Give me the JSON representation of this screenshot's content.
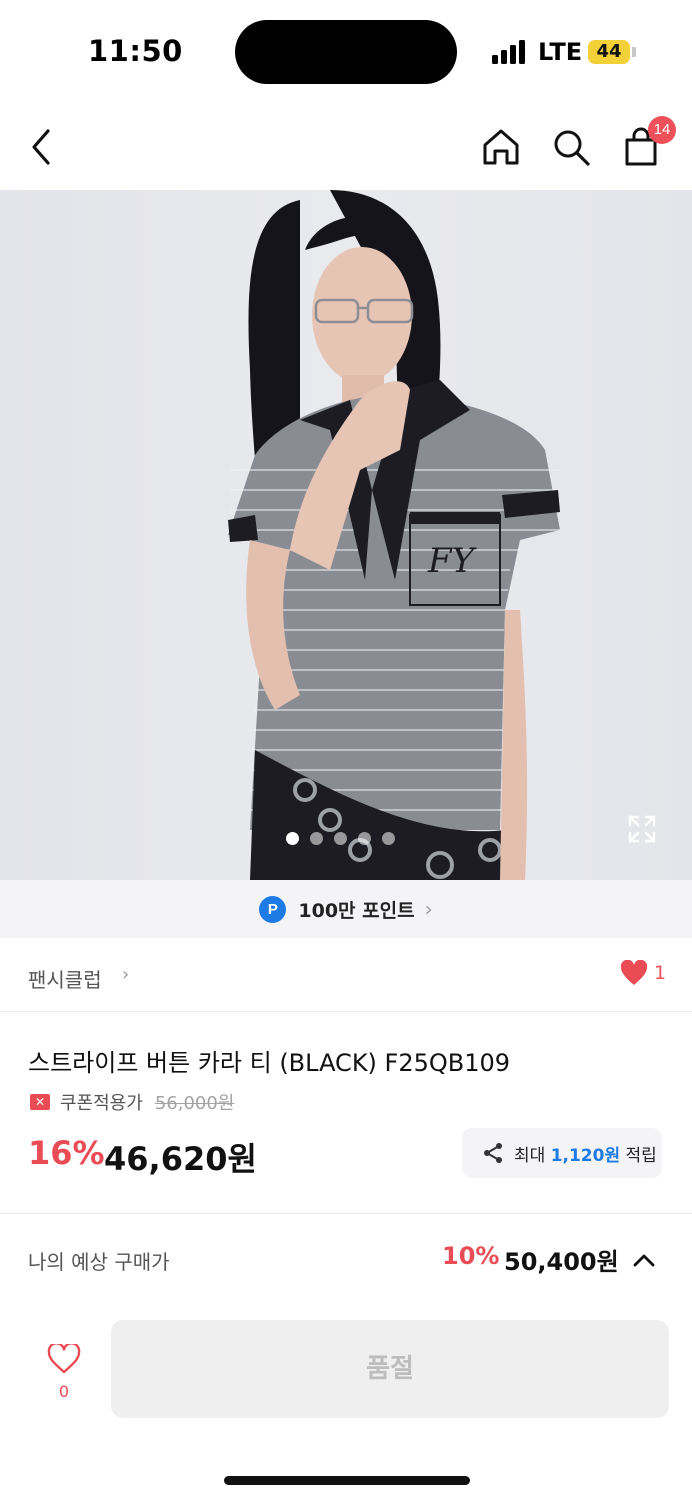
{
  "status_bar": {
    "time": "11:50",
    "carrier": "LTE",
    "battery": "44"
  },
  "nav": {
    "cart_count": "14"
  },
  "hero": {
    "image_alt": "모델이 착용한 스트라이프 버튼 카라 티",
    "page_index": 1,
    "page_total": 5
  },
  "points": {
    "badge": "P",
    "label": "100만 포인트",
    "chevron": "›"
  },
  "brand": {
    "name": "팬시클럽",
    "chevron": "›",
    "like_count": "1"
  },
  "product": {
    "name": "스트라이프 버튼 카라 티 (BLACK) F25QB109",
    "coupon_icon": "✕",
    "coupon_label": "쿠폰적용가",
    "original_price": "56,000원",
    "discount_rate": "16%",
    "sale_price": "46,620원"
  },
  "share": {
    "prefix": "최대 ",
    "amount": "1,120원",
    "suffix": " 적립"
  },
  "expected": {
    "label": "나의 예상 구매가",
    "discount_rate": "10%",
    "price": "50,400원"
  },
  "bottom": {
    "wish_count": "0",
    "soldout_label": "품절"
  },
  "colors": {
    "accent_red": "#ea4c55",
    "accent_blue": "#1e7be6",
    "badge_red": "#f0505a"
  },
  "icons": [
    "back-icon",
    "home-icon",
    "search-icon",
    "cart-icon",
    "expand-icon",
    "heart-icon",
    "share-icon",
    "chevron-up-icon"
  ]
}
